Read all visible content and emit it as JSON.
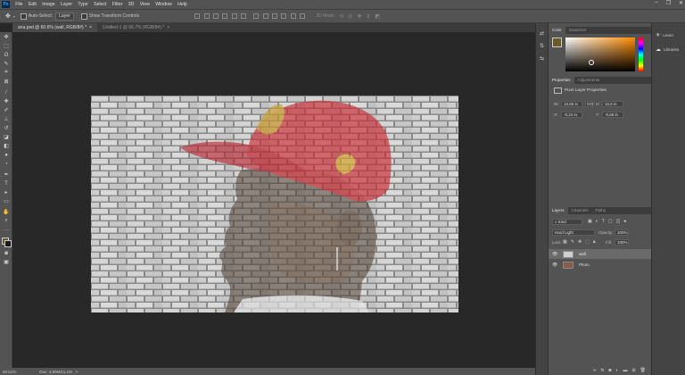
{
  "menu": {
    "items": [
      "File",
      "Edit",
      "Image",
      "Layer",
      "Type",
      "Select",
      "Filter",
      "3D",
      "View",
      "Window",
      "Help"
    ],
    "logo": "Ps"
  },
  "window_controls": {
    "minimize": "–",
    "restore": "❐",
    "close": "✕"
  },
  "options": {
    "auto_select_label": "Auto-Select:",
    "auto_select_value": "Layer",
    "show_transform_label": "Show Transform Controls",
    "mode_3d_label": "3D Mode:"
  },
  "tabs": [
    {
      "label": "ana.psd @ 60.6% (wall, RGB/8#) *",
      "close": "×"
    },
    {
      "label": "Untitled-1 @ 66.7% (RGB/8#) *",
      "close": "×"
    }
  ],
  "status": {
    "zoom": "60.61%",
    "doc": "Doc: 4,80M/11,1M",
    "arrow": ">"
  },
  "color_panel": {
    "tab_color": "Color",
    "tab_swatches": "Swatches",
    "fg": "#6b5a2a",
    "bg": "#1b1b1b"
  },
  "properties": {
    "tab_properties": "Properties",
    "tab_adjustments": "Adjustments",
    "title": "Pixel Layer Properties",
    "w_label": "W:",
    "w_value": "13,85 in",
    "h_label": "H:",
    "h_value": "15,5 in",
    "link": "GO",
    "x_label": "X:",
    "x_value": "-0,24 in",
    "y_label": "Y:",
    "y_value": "-0,58 in"
  },
  "layers": {
    "tab_layers": "Layers",
    "tab_channels": "Channels",
    "tab_paths": "Paths",
    "kind": "Kind",
    "blend_mode": "Hard Light",
    "opacity_label": "Opacity:",
    "opacity_value": "100%",
    "lock_label": "Lock:",
    "fill_label": "Fill:",
    "fill_value": "100%",
    "items": [
      {
        "name": "wall"
      },
      {
        "name": "Photo"
      }
    ]
  },
  "right_panel": {
    "learn": "Learn",
    "libraries": "Libraries"
  }
}
